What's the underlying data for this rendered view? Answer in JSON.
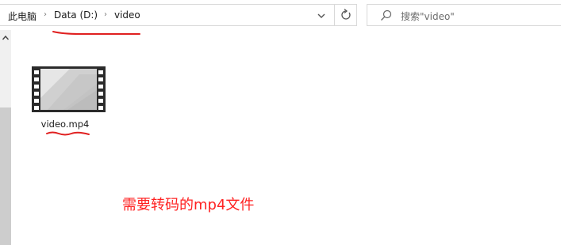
{
  "breadcrumb": {
    "items": [
      "此电脑",
      "Data (D:)",
      "video"
    ]
  },
  "search": {
    "placeholder": "搜索\"video\""
  },
  "file": {
    "name": "video.mp4",
    "type_icon": "video-file-icon"
  },
  "annotation": {
    "text": "需要转码的mp4文件",
    "color": "#ff2222"
  },
  "colors": {
    "annotation_red": "#ff2222",
    "border": "#d9d9d9",
    "scrollbar": "#f0f0f0"
  }
}
